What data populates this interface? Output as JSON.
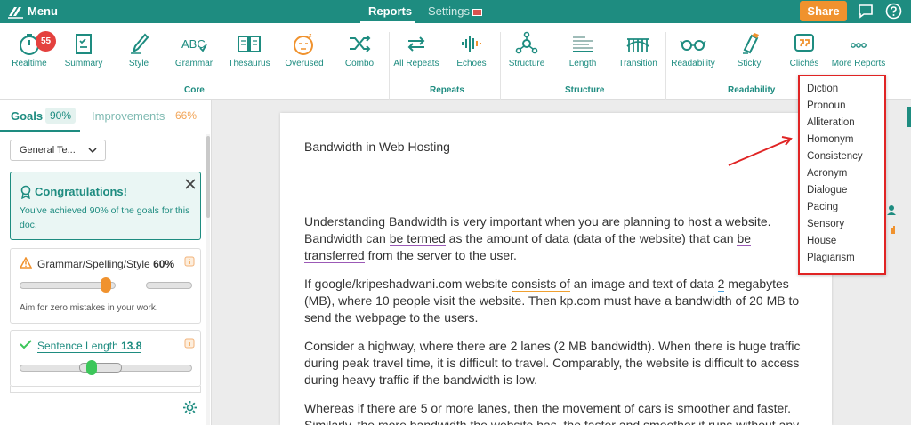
{
  "topbar": {
    "menu_label": "Menu",
    "tabs": [
      {
        "label": "Reports",
        "active": true
      },
      {
        "label": "Settings",
        "active": false
      }
    ],
    "share_label": "Share",
    "colors": {
      "bar": "#1e8c80",
      "share": "#f0922e"
    }
  },
  "toolbar": {
    "realtime_badge": "55",
    "tools": [
      {
        "label": "Realtime",
        "icon": "stopwatch-icon"
      },
      {
        "label": "Summary",
        "icon": "clipboard-icon"
      },
      {
        "label": "Style",
        "icon": "pen-icon"
      },
      {
        "label": "Grammar",
        "icon": "abc-check-icon"
      },
      {
        "label": "Thesaurus",
        "icon": "book-icon"
      },
      {
        "label": "Overused",
        "icon": "sleepy-face-icon"
      },
      {
        "label": "Combo",
        "icon": "shuffle-icon"
      },
      {
        "label": "All Repeats",
        "icon": "repeat-icon"
      },
      {
        "label": "Echoes",
        "icon": "soundwave-icon"
      },
      {
        "label": "Structure",
        "icon": "nodes-icon"
      },
      {
        "label": "Length",
        "icon": "ruler-icon"
      },
      {
        "label": "Transition",
        "icon": "bridge-icon"
      },
      {
        "label": "Readability",
        "icon": "glasses-icon"
      },
      {
        "label": "Sticky",
        "icon": "glue-icon"
      },
      {
        "label": "Clichés",
        "icon": "quote-icon"
      },
      {
        "label": "More Reports",
        "icon": "more-dots-icon"
      }
    ],
    "groups": [
      "Core",
      "Repeats",
      "Structure",
      "Readability"
    ]
  },
  "left_panel": {
    "tab_goals": "Goals",
    "goals_pct": "90%",
    "tab_improvements": "Improvements",
    "improvements_pct": "66%",
    "dropdown_value": "General Te...",
    "congrats_title": "Congratulations!",
    "congrats_body": "You've achieved 90% of the goals for this doc.",
    "cards": [
      {
        "name": "Grammar/Spelling/Style",
        "value": "60%",
        "hint": "Aim for zero mistakes in your work.",
        "knob_color": "#f0922e",
        "level": 0.5
      },
      {
        "name": "Sentence Length",
        "value": "13.8",
        "knob_color": "#3cc65a",
        "level": 0.42
      }
    ]
  },
  "document": {
    "title": "Bandwidth in Web Hosting",
    "p1": {
      "a": "Understanding Bandwidth is very important when you are planning to host a website. Bandwidth can ",
      "u1": "be termed",
      "b": " as the amount of data (data of the website) that can ",
      "u2": "be transferred",
      "c": " from the server to the user."
    },
    "p2": {
      "a": "If google/kripeshadwani.com website ",
      "u1": "consists of",
      "b": " an image and text of data ",
      "u2": "2",
      "c": " megabytes (MB), where 10 people visit the website. Then kp.com must have a bandwidth of 20 MB to send the webpage to the users."
    },
    "p3": "Consider a highway, where there are 2 lanes (2 MB bandwidth). When there is huge traffic during peak travel time, it is difficult to travel. Comparably, the website is difficult to access during heavy traffic if the bandwidth is low.",
    "p4": "Whereas if there are 5 or more lanes, then the movement of cars is smoother and faster. Similarly, the more bandwidth the website has, the faster and smoother it runs without any"
  },
  "more_reports": [
    "Diction",
    "Pronoun",
    "Alliteration",
    "Homonym",
    "Consistency",
    "Acronym",
    "Dialogue",
    "Pacing",
    "Sensory",
    "House",
    "Plagiarism"
  ]
}
